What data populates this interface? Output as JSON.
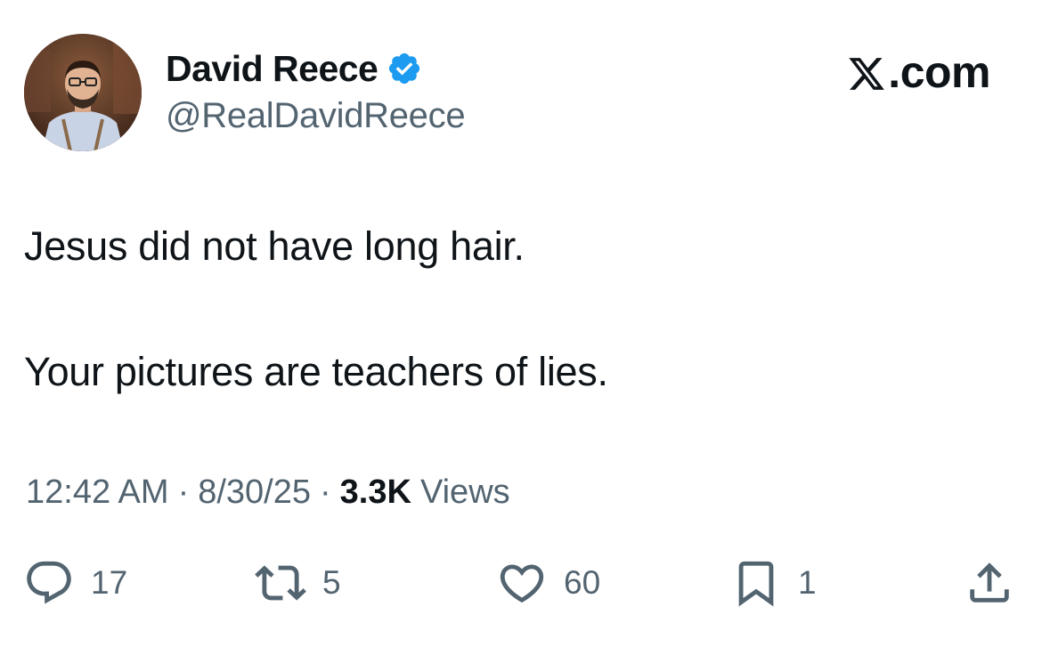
{
  "author": {
    "display_name": "David Reece",
    "handle": "@RealDavidReece",
    "verified_icon": "verified-badge-icon",
    "badge_color": "#1d9bf0"
  },
  "source": {
    "site": ".com",
    "icon": "x-logo-icon"
  },
  "tweet": {
    "line1": "Jesus did not have long hair.",
    "line2": "Your pictures are teachers of lies."
  },
  "meta": {
    "time": "12:42 AM",
    "separator": "·",
    "date": "8/30/25",
    "views_count": "3.3K",
    "views_label": "Views"
  },
  "actions": {
    "replies": "17",
    "reposts": "5",
    "likes": "60",
    "bookmarks": "1",
    "icons": [
      "reply-icon",
      "repost-icon",
      "like-icon",
      "bookmark-icon",
      "share-icon"
    ]
  },
  "colors": {
    "text": "#0f1419",
    "secondary": "#536471",
    "accent": "#1d9bf0"
  }
}
